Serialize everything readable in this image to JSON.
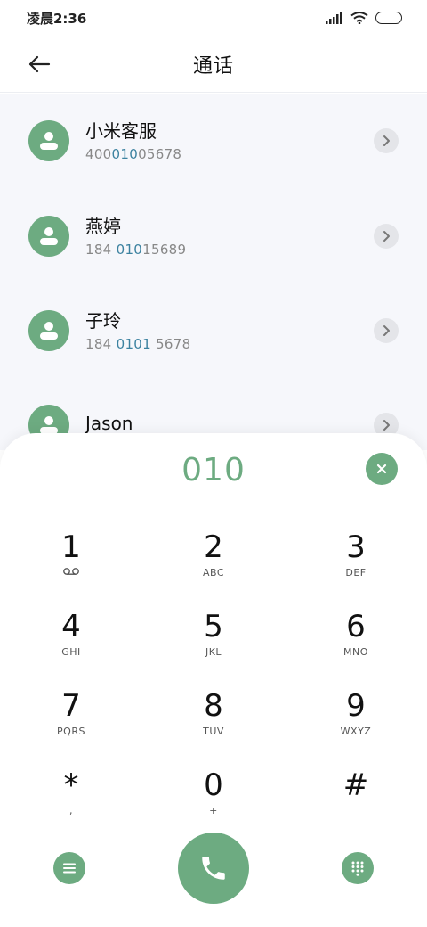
{
  "status_bar": {
    "time": "凌晨2:36"
  },
  "header": {
    "title": "通话",
    "back_icon": "arrow-left-icon"
  },
  "contacts": [
    {
      "name": "小米客服",
      "number_pre": "400",
      "number_match": "010",
      "number_post": "05678"
    },
    {
      "name": "燕婷",
      "number_pre": "184 ",
      "number_match": "010",
      "number_post": "15689"
    },
    {
      "name": "子玲",
      "number_pre": "184 ",
      "number_match": "0101",
      "number_post": " 5678"
    },
    {
      "name": "Jason",
      "number_pre": "",
      "number_match": "",
      "number_post": ""
    }
  ],
  "dialer": {
    "input_value": "010",
    "keys": [
      {
        "digit": "1",
        "letters": ""
      },
      {
        "digit": "2",
        "letters": "ABC"
      },
      {
        "digit": "3",
        "letters": "DEF"
      },
      {
        "digit": "4",
        "letters": "GHI"
      },
      {
        "digit": "5",
        "letters": "JKL"
      },
      {
        "digit": "6",
        "letters": "MNO"
      },
      {
        "digit": "7",
        "letters": "PQRS"
      },
      {
        "digit": "8",
        "letters": "TUV"
      },
      {
        "digit": "9",
        "letters": "WXYZ"
      },
      {
        "digit": "*",
        "letters": ","
      },
      {
        "digit": "0",
        "letters": "+"
      },
      {
        "digit": "#",
        "letters": ""
      }
    ]
  },
  "colors": {
    "accent": "#6dab81",
    "match_highlight": "#3c82a0",
    "list_background": "#f6f7fb"
  },
  "icons": {
    "key1_sub": "voicemail-icon",
    "clear": "close-icon",
    "menu": "menu-icon",
    "call": "phone-icon",
    "keypad_toggle": "dialpad-icon",
    "chevron": "chevron-right-icon",
    "avatar": "person-icon"
  }
}
